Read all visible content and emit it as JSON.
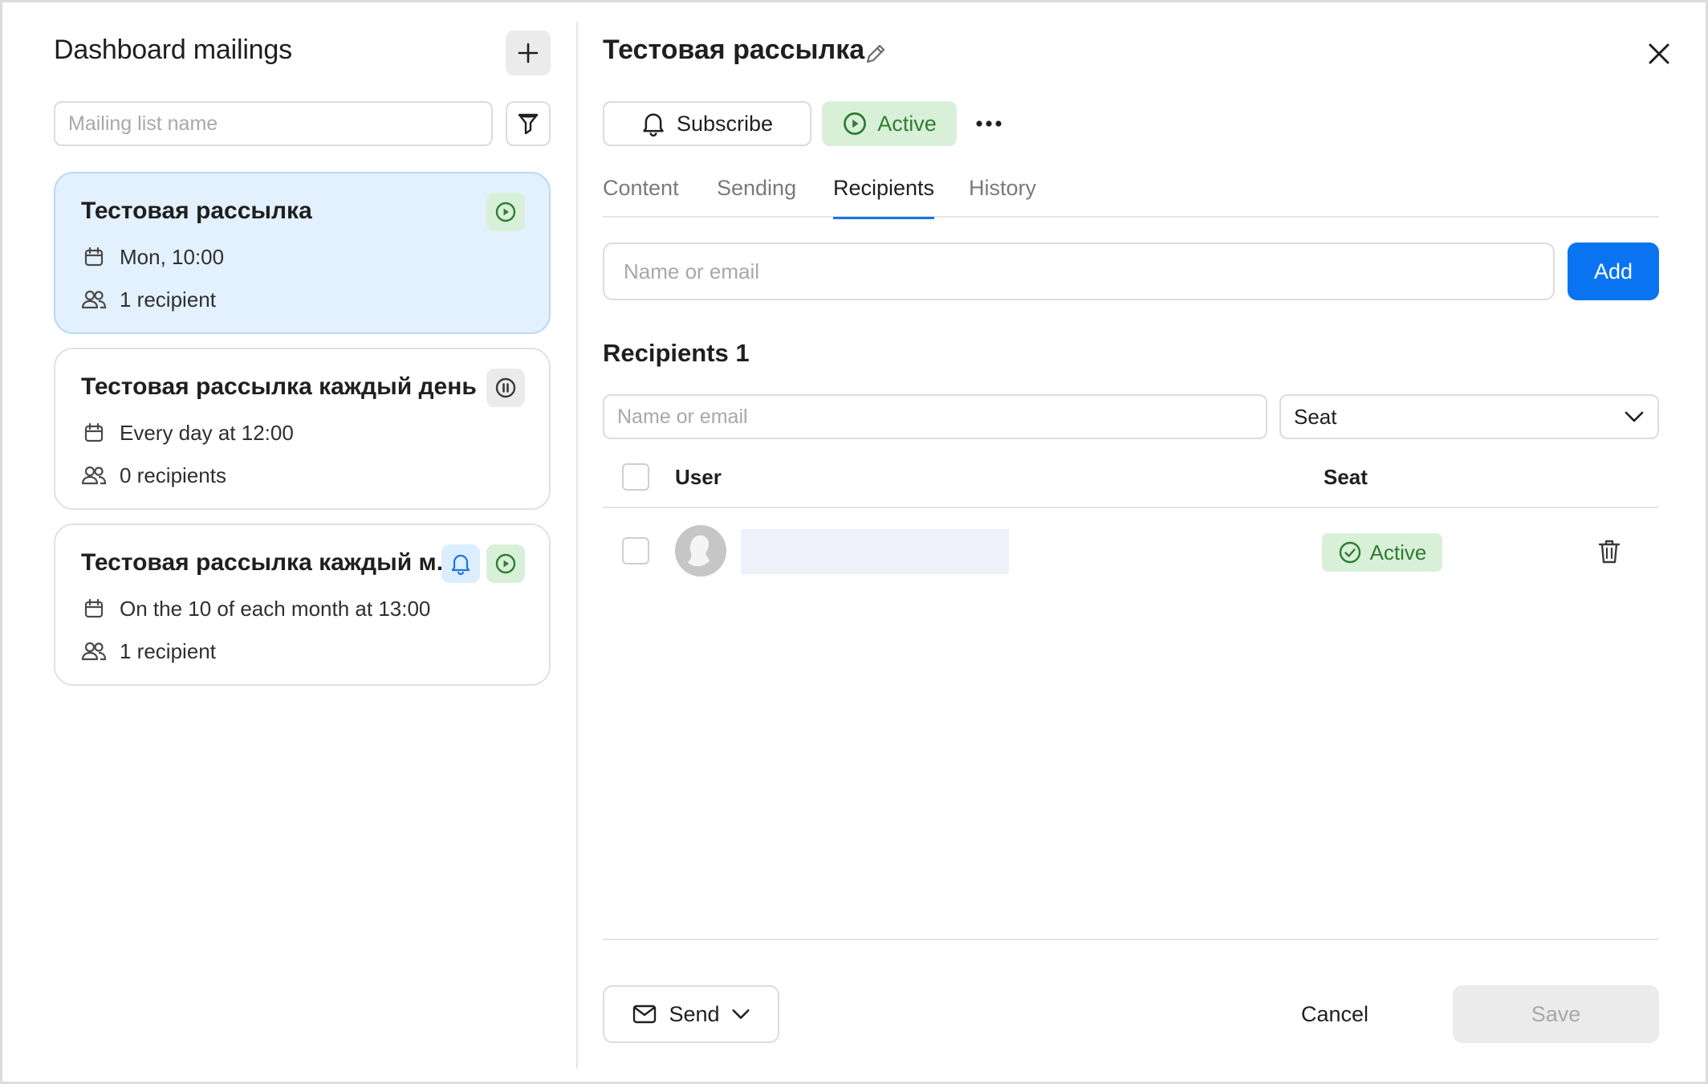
{
  "sidebar": {
    "title": "Dashboard mailings",
    "search_placeholder": "Mailing list name",
    "mailings": [
      {
        "title": "Тестовая рассылка",
        "schedule": "Mon, 10:00",
        "recipients": "1 recipient",
        "status": "active"
      },
      {
        "title": "Тестовая рассылка каждый день",
        "schedule": "Every day at 12:00",
        "recipients": "0 recipients",
        "status": "paused"
      },
      {
        "title": "Тестовая рассылка каждый м...",
        "schedule": "On the 10 of each month at 13:00",
        "recipients": "1 recipient",
        "status": "active",
        "subscribed": true
      }
    ]
  },
  "detail": {
    "title": "Тестовая рассылка",
    "subscribe_label": "Subscribe",
    "status_label": "Active",
    "tabs": [
      {
        "label": "Content",
        "active": false
      },
      {
        "label": "Sending",
        "active": false
      },
      {
        "label": "Recipients",
        "active": true
      },
      {
        "label": "History",
        "active": false
      }
    ],
    "add_placeholder": "Name or email",
    "add_label": "Add",
    "recipients_heading": "Recipients 1",
    "filter_placeholder": "Name or email",
    "seat_filter_value": "Seat",
    "table": {
      "columns": [
        "User",
        "Seat"
      ],
      "rows": [
        {
          "user": "",
          "seat": "Active"
        }
      ]
    },
    "footer": {
      "send_label": "Send",
      "cancel_label": "Cancel",
      "save_label": "Save"
    }
  },
  "colors": {
    "accent": "#0a74f0",
    "active_green": "#2e7d32",
    "active_bg": "#d8f0d8",
    "selected_card_bg": "#e3f0fd"
  },
  "icons": [
    "plus-icon",
    "filter-icon",
    "play-icon",
    "pause-icon",
    "bell-icon",
    "calendar-icon",
    "users-icon",
    "pencil-icon",
    "close-icon",
    "more-icon",
    "chevron-down-icon",
    "check-circle-icon",
    "trash-icon",
    "mail-icon"
  ]
}
